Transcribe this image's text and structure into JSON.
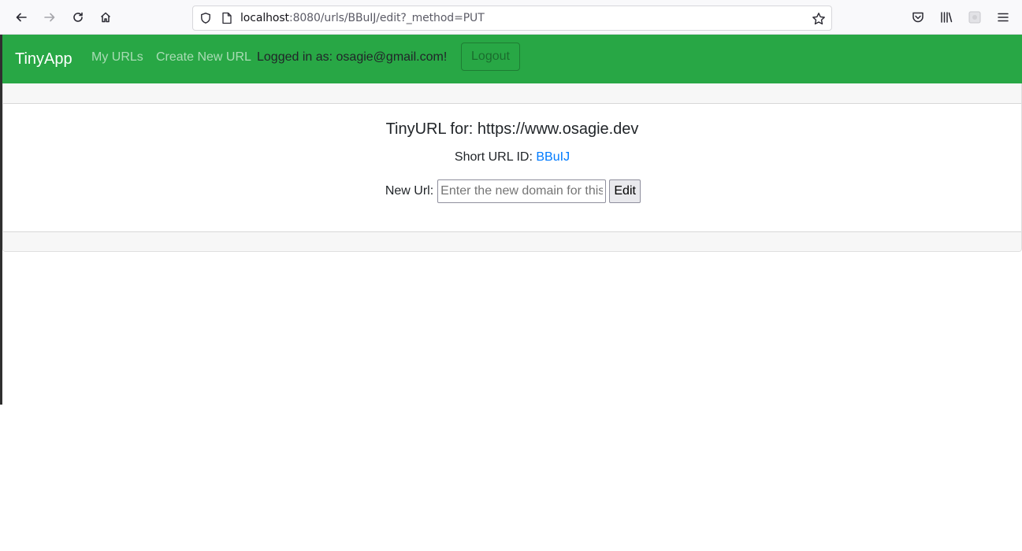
{
  "browser": {
    "url_host": "localhost",
    "url_rest": ":8080/urls/BBuIJ/edit?_method=PUT"
  },
  "navbar": {
    "brand": "TinyApp",
    "my_urls": "My URLs",
    "create_new_url": "Create New URL",
    "logged_in_text": "Logged in as: osagie@gmail.com!",
    "logout_label": "Logout"
  },
  "card": {
    "title": "TinyURL for: https://www.osagie.dev",
    "short_url_label": "Short URL ID:",
    "short_url_id": "BBuIJ",
    "new_url_label": "New Url:",
    "new_url_placeholder": "Enter the new domain for this",
    "new_url_value": "",
    "edit_label": "Edit"
  },
  "colors": {
    "navbar_bg": "#28a745",
    "link": "#007bff"
  }
}
